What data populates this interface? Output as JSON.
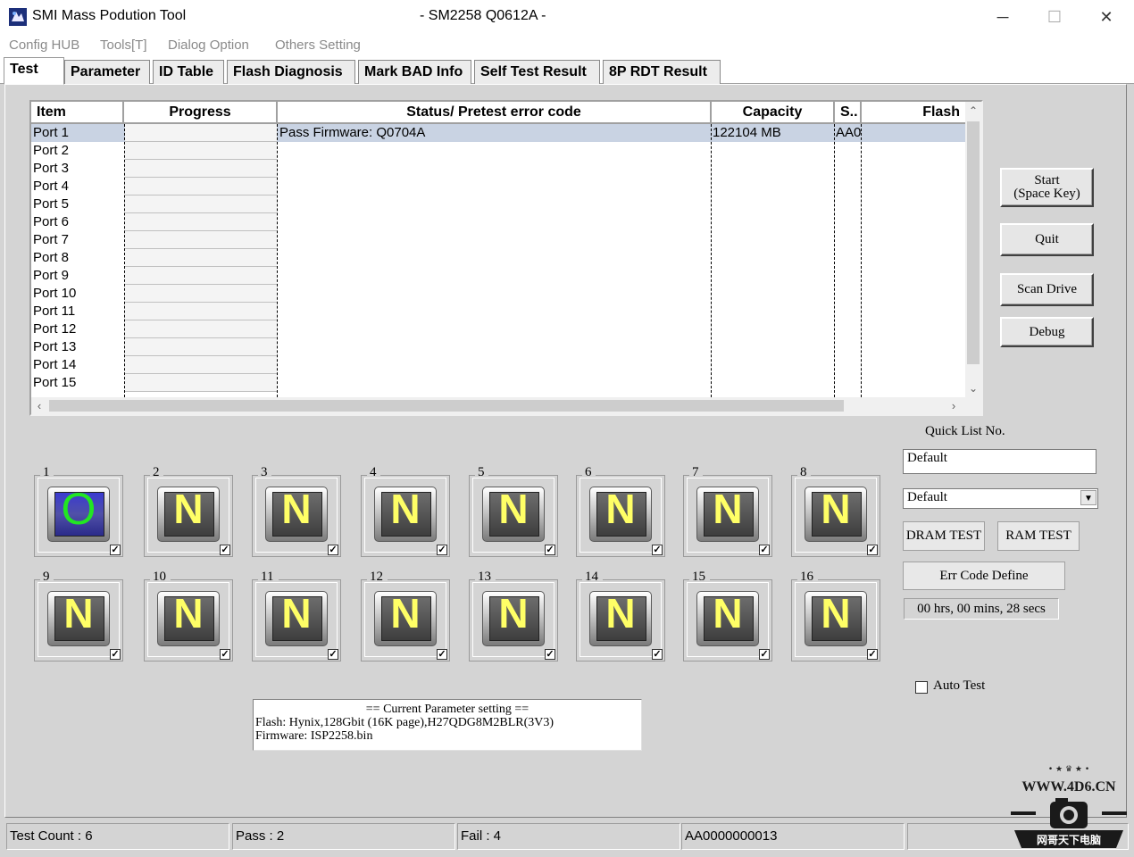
{
  "window": {
    "title": "SMI Mass Podution Tool",
    "subtitle": "- SM2258 Q0612A -",
    "minimize": "─",
    "maximize": "☐",
    "close": "✕"
  },
  "menu": [
    "Config HUB",
    "Tools[T]",
    "Dialog Option",
    "Others Setting"
  ],
  "tabs": [
    "Test",
    "Parameter",
    "ID Table",
    "Flash Diagnosis",
    "Mark BAD Info",
    "Self Test Result",
    "8P RDT Result"
  ],
  "list": {
    "columns": [
      "Item",
      "Progress",
      "Status/ Pretest error code",
      "Capacity",
      "S..",
      "Flash"
    ],
    "rows": [
      {
        "item": "Port 1",
        "status": "Pass    Firmware: Q0704A",
        "capacity": "122104 MB",
        "s": "AA0"
      },
      {
        "item": "Port 2"
      },
      {
        "item": "Port 3"
      },
      {
        "item": "Port 4"
      },
      {
        "item": "Port 5"
      },
      {
        "item": "Port 6"
      },
      {
        "item": "Port 7"
      },
      {
        "item": "Port 8"
      },
      {
        "item": "Port 9"
      },
      {
        "item": "Port 10"
      },
      {
        "item": "Port 11"
      },
      {
        "item": "Port 12"
      },
      {
        "item": "Port 13"
      },
      {
        "item": "Port 14"
      },
      {
        "item": "Port 15"
      }
    ]
  },
  "buttons": {
    "start": "Start\n(Space Key)",
    "quit": "Quit",
    "scan": "Scan Drive",
    "debug": "Debug",
    "dram": "DRAM TEST",
    "ram": "RAM TEST",
    "errcode": "Err Code Define"
  },
  "quick_list": {
    "label": "Quick List No.",
    "value": "Default",
    "combo": "Default"
  },
  "timer": "00 hrs, 00 mins, 28 secs",
  "auto_test": "Auto Test",
  "ports": [
    {
      "num": "1",
      "state": "O",
      "ok": true
    },
    {
      "num": "2",
      "state": "N"
    },
    {
      "num": "3",
      "state": "N"
    },
    {
      "num": "4",
      "state": "N"
    },
    {
      "num": "5",
      "state": "N"
    },
    {
      "num": "6",
      "state": "N"
    },
    {
      "num": "7",
      "state": "N"
    },
    {
      "num": "8",
      "state": "N"
    },
    {
      "num": "9",
      "state": "N"
    },
    {
      "num": "10",
      "state": "N"
    },
    {
      "num": "11",
      "state": "N"
    },
    {
      "num": "12",
      "state": "N"
    },
    {
      "num": "13",
      "state": "N"
    },
    {
      "num": "14",
      "state": "N"
    },
    {
      "num": "15",
      "state": "N"
    },
    {
      "num": "16",
      "state": "N"
    }
  ],
  "param": {
    "title": "== Current Parameter setting ==",
    "flash": "Flash:   Hynix,128Gbit (16K page),H27QDG8M2BLR(3V3)",
    "firmware": "Firmware:   ISP2258.bin"
  },
  "status": {
    "count": "Test Count : 6",
    "pass": "Pass : 2",
    "fail": "Fail : 4",
    "serial": "AA0000000013",
    "extra": ""
  },
  "watermark": {
    "stars": "• ★ ♛ ★ •",
    "site": "WWW.4D6.CN",
    "banner": "网哥天下电脑"
  }
}
